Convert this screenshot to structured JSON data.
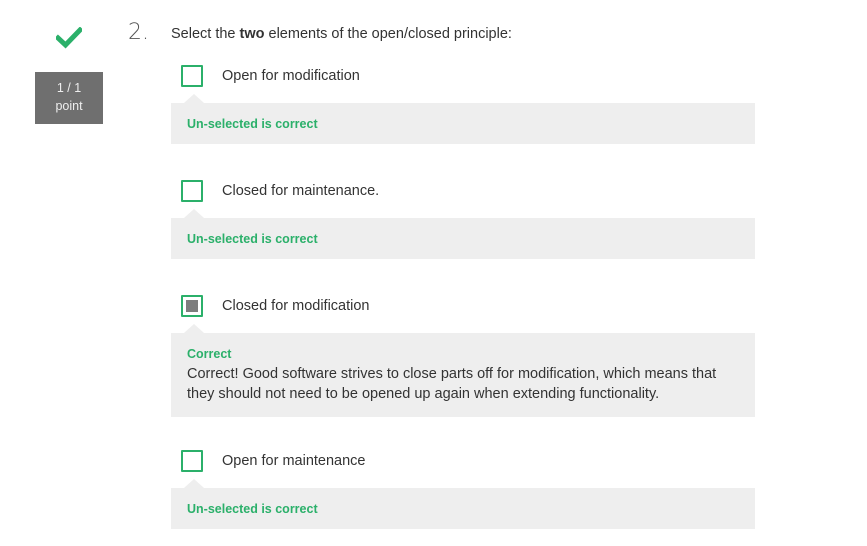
{
  "header": {
    "number": "2.",
    "prompt_before": "Select the ",
    "prompt_bold": "two",
    "prompt_after": " elements of the open/closed principle:"
  },
  "score": {
    "value": "1 / 1",
    "unit": "point"
  },
  "status_icon": "checkmark-icon",
  "colors": {
    "accent_green": "#2bb06a",
    "score_bg": "#6f6f6f",
    "feedback_bg": "#eeeeee"
  },
  "options": [
    {
      "label": "Open for modification",
      "checked": false,
      "feedback_status": "Un-selected is correct",
      "feedback_text": ""
    },
    {
      "label": "Closed for maintenance.",
      "checked": false,
      "feedback_status": "Un-selected is correct",
      "feedback_text": ""
    },
    {
      "label": "Closed for modification",
      "checked": true,
      "feedback_status": "Correct",
      "feedback_text": "Correct! Good software strives to close parts off for modification, which means that they should not need to be opened up again when extending functionality."
    },
    {
      "label": "Open for maintenance",
      "checked": false,
      "feedback_status": "Un-selected is correct",
      "feedback_text": ""
    }
  ]
}
